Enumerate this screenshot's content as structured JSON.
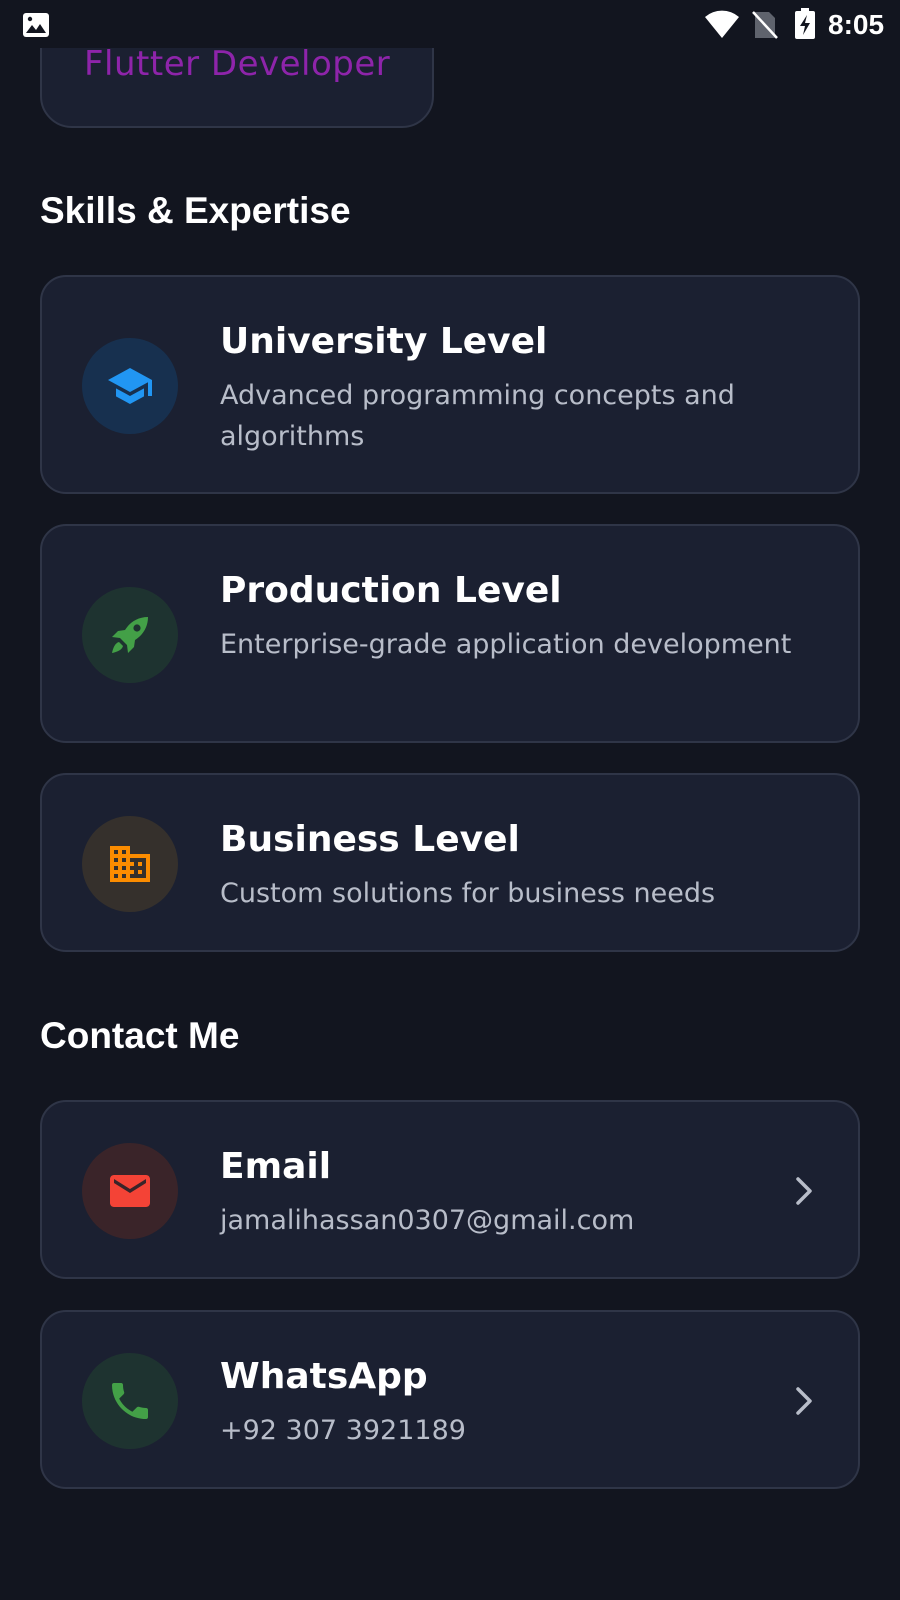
{
  "status_bar": {
    "time": "8:05"
  },
  "profile": {
    "role": "Flutter Developer",
    "role_color": "#8e24aa"
  },
  "skills": {
    "title": "Skills & Expertise",
    "items": [
      {
        "title": "University Level",
        "description": "Advanced programming concepts and algorithms",
        "icon": "graduation-cap-icon",
        "color": "#2196f3"
      },
      {
        "title": "Production Level",
        "description": "Enterprise-grade application development",
        "icon": "rocket-icon",
        "color": "#43a047"
      },
      {
        "title": "Business Level",
        "description": "Custom solutions for business needs",
        "icon": "business-building-icon",
        "color": "#fb8c00"
      }
    ]
  },
  "contact": {
    "title": "Contact Me",
    "items": [
      {
        "label": "Email",
        "value": "jamalihassan0307@gmail.com",
        "icon": "mail-icon",
        "color": "#f44336"
      },
      {
        "label": "WhatsApp",
        "value": "+92 307 3921189",
        "icon": "phone-icon",
        "color": "#43a047"
      }
    ]
  },
  "colors": {
    "background": "#12151f",
    "card": "#1b2031",
    "card_border": "#2f3547",
    "secondary_text": "#b8bdc9"
  }
}
